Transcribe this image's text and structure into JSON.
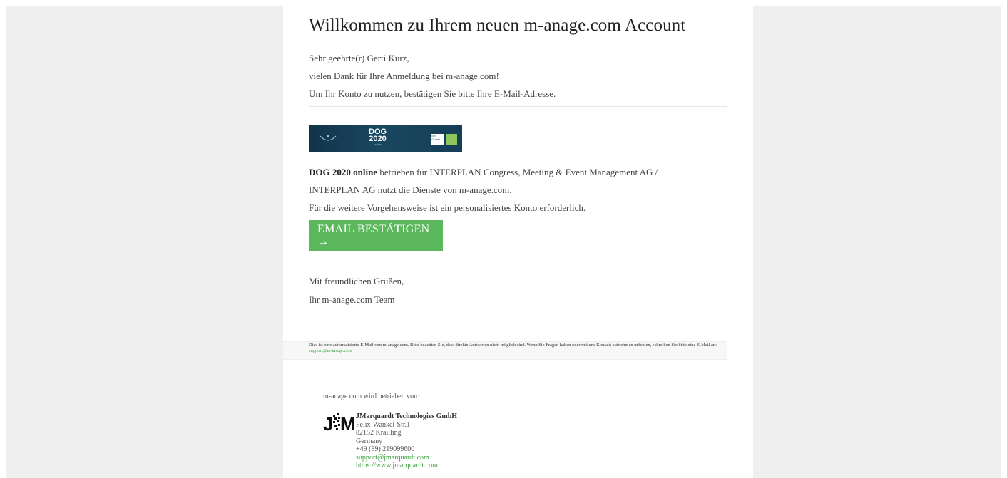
{
  "email": {
    "title": "Willkommen zu Ihrem neuen m-anage.com Account",
    "greeting": "Sehr geehrte(r) Gerti Kurz,",
    "thanks": "vielen Dank für Ihre Anmeldung bei m-anage.com!",
    "confirm_hint": "Um Ihr Konto zu nutzen, bestätigen Sie bitte Ihre E-Mail-Adresse.",
    "banner": {
      "line1": "DOG",
      "line2": "2020",
      "line3": "online",
      "logo_a_text": "von Graefe"
    },
    "event_name": "DOG 2020 online",
    "event_text": " betrieben für INTERPLAN Congress, Meeting & Event Management AG /",
    "event_line2": "INTERPLAN AG nutzt die Dienste von m-anage.com.",
    "event_line3": "Für die weitere Vorgehensweise ist ein personalisiertes Konto erforderlich.",
    "cta_label": "EMAIL BESTÄTIGEN →",
    "closing": "Mit freundlichen Grüßen,",
    "signature": "Ihr m-anage.com Team"
  },
  "notice": {
    "text": "Dies ist eine automatisierte E-Mail von m-anage.com. Bitte beachten Sie, dass direkte Antworten nicht möglich sind. Wenn Sie Fragen haben oder mit uns Kontakt aufnehmen möchten, schreiben Sie bitte eine E-Mail an: ",
    "email": "support@m-anage.com"
  },
  "footer": {
    "operated_by": "m-anage.com wird betrieben von:",
    "company": "JMarquardt Technologies GmbH",
    "street": "Felix-Wankel-Str.1",
    "city": "82152 Krailling",
    "country": "Germany",
    "phone": "+49 (89) 219099600",
    "email": "support@jmarquardt.com",
    "website": "https://www.jmarquardt.com"
  },
  "colors": {
    "button": "#5cb85c",
    "link": "#3aa23a",
    "page_bg": "#efefef"
  }
}
